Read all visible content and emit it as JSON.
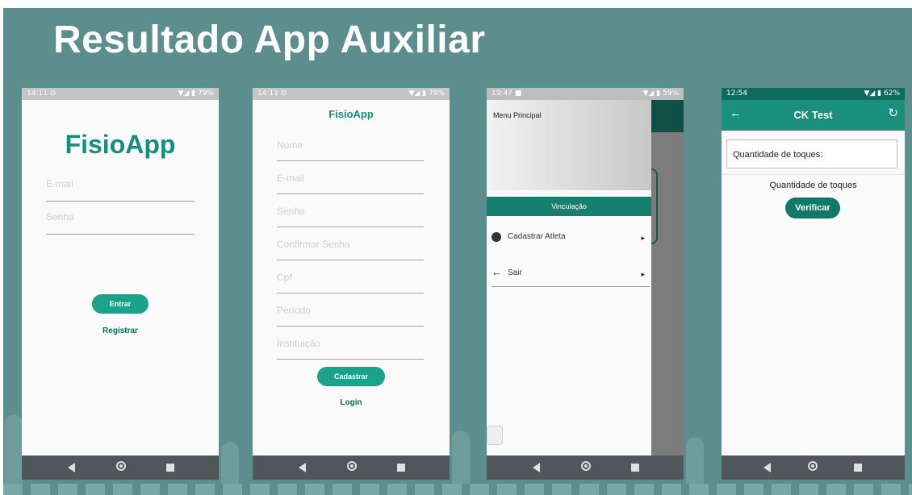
{
  "slide": {
    "title": "Resultado App Auxiliar"
  },
  "screens": {
    "login": {
      "time": "14:11 ⊙",
      "system": "▼◢ ▮ 79%",
      "app_title": "FisioApp",
      "email_placeholder": "E-mail",
      "password_placeholder": "Senha",
      "enter_label": "Entrar",
      "register_label": "Registrar"
    },
    "register": {
      "time": "14:11 ⊙",
      "system": "▼◢ ▮ 79%",
      "app_title": "FisioApp",
      "fields": [
        "Nome",
        "E-mail",
        "Senha",
        "Confirmar Senha",
        "Cpf",
        "Período",
        "Instituição"
      ],
      "submit_label": "Cadastrar",
      "login_label": "Login"
    },
    "menu": {
      "time": "19:47 ■",
      "system": "▼◢ ▮ 59%",
      "header_label": "Menu Principal",
      "section_label": "Vinculação",
      "items": [
        {
          "label": "Cadastrar Atleta",
          "icon": "account-circle-icon"
        },
        {
          "label": "Sair",
          "icon": "arrow-left-icon"
        }
      ]
    },
    "cktest": {
      "time": "12:54",
      "system": "▼◢ ▮ 62%",
      "toolbar_title": "CK Test",
      "card_label": "Quantidade de toques:",
      "result_label": "Quantidade de toques",
      "verify_label": "Verificar"
    }
  },
  "colors": {
    "background": "#5b8e8c",
    "accent": "#1ba28b",
    "toolbar": "#1a8f7c",
    "nav": "#505659"
  }
}
